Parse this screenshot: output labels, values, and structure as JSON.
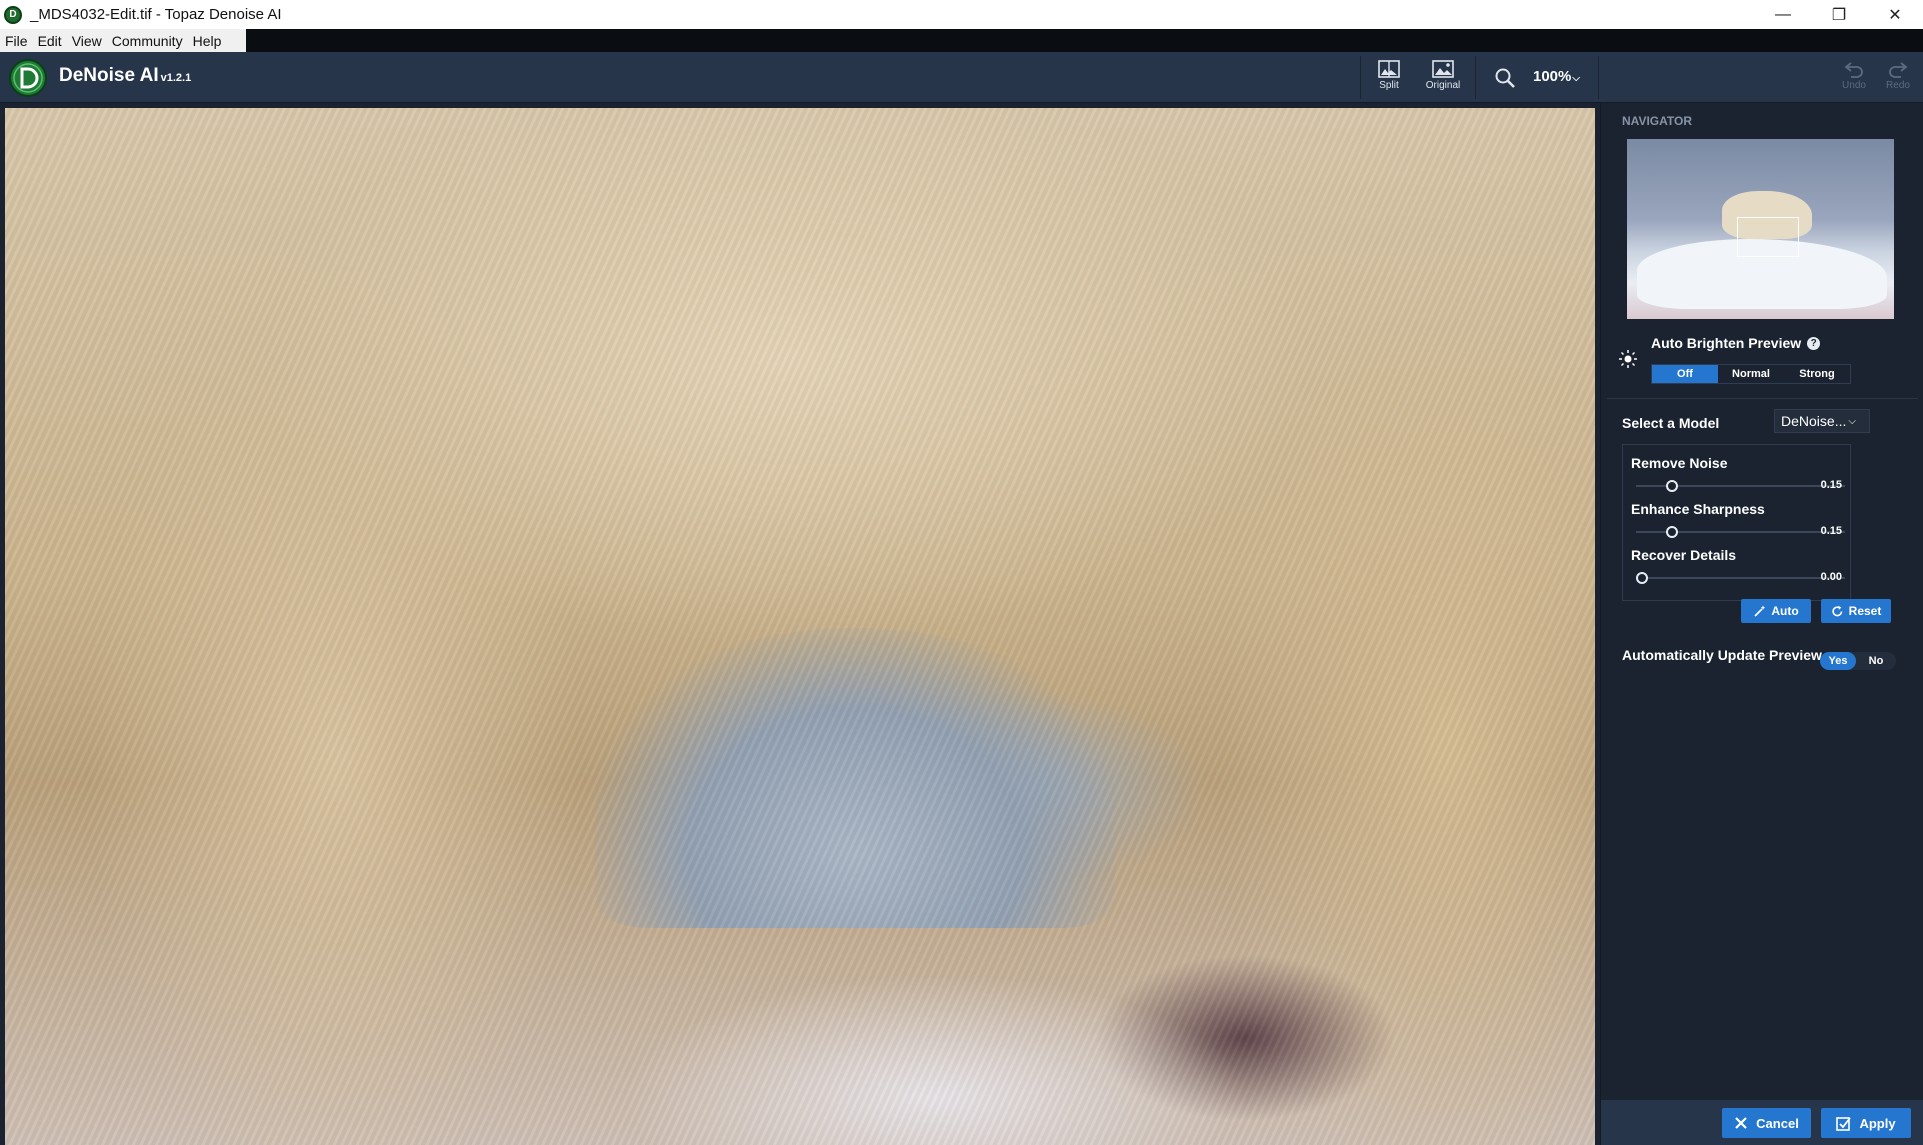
{
  "window": {
    "title": "_MDS4032-Edit.tif - Topaz Denoise AI",
    "app_icon_letter": "D",
    "controls": {
      "minimize": "—",
      "restore": "❐",
      "close": "✕"
    }
  },
  "menubar": {
    "items": [
      "File",
      "Edit",
      "View",
      "Community",
      "Help"
    ]
  },
  "toolbar": {
    "brand": "DeNoise AI",
    "version": "v1.2.1",
    "split_label": "Split",
    "original_label": "Original",
    "zoom_value": "100%",
    "undo_label": "Undo",
    "redo_label": "Redo"
  },
  "navigator": {
    "label": "NAVIGATOR"
  },
  "auto_brighten": {
    "label": "Auto Brighten Preview",
    "help": "?",
    "options": [
      "Off",
      "Normal",
      "Strong"
    ],
    "selected": "Off"
  },
  "model": {
    "label": "Select a Model",
    "value": "DeNoise..."
  },
  "sliders": [
    {
      "label": "Remove Noise",
      "value": "0.15",
      "level": 0.15
    },
    {
      "label": "Enhance Sharpness",
      "value": "0.15",
      "level": 0.15
    },
    {
      "label": "Recover Details",
      "value": "0.00",
      "level": 0.0
    }
  ],
  "slider_actions": {
    "auto": "Auto",
    "reset": "Reset"
  },
  "auto_update": {
    "label": "Automatically Update Preview",
    "yes": "Yes",
    "no": "No",
    "selected": "Yes"
  },
  "footer": {
    "cancel": "Cancel",
    "apply": "Apply"
  },
  "colors": {
    "accent": "#2476cf",
    "panel": "#1b2330",
    "toolbar": "#26354a"
  },
  "icons": [
    "app-icon",
    "split-icon",
    "original-icon",
    "zoom-icon",
    "undo-icon",
    "redo-icon",
    "sun-icon",
    "help-icon",
    "wand-icon",
    "reset-icon",
    "close-icon",
    "check-icon"
  ]
}
